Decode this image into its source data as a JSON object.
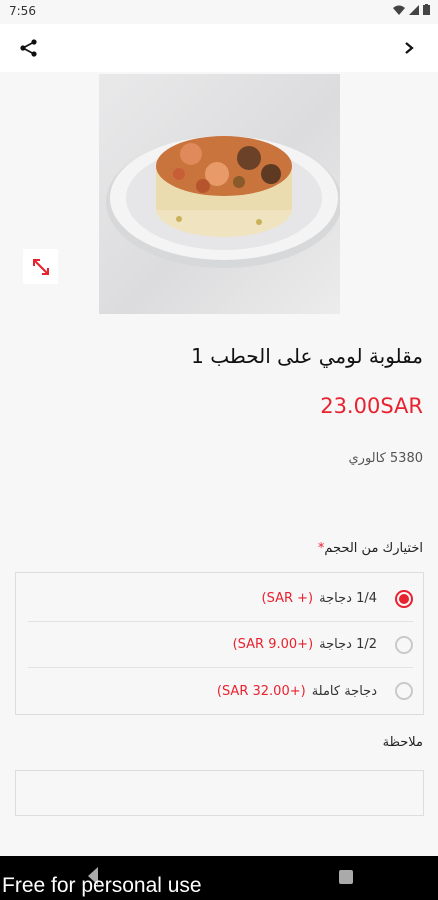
{
  "status_bar": {
    "time": "7:56"
  },
  "app_bar": {
    "share_icon": "share-icon",
    "forward_icon": "chevron-right-icon"
  },
  "product": {
    "title": "مقلوبة لومي على الحطب 1",
    "price": "23.00SAR",
    "calories": "5380 كالوري"
  },
  "size_section": {
    "label": "اختيارك من الحجم",
    "required_mark": "*",
    "options": [
      {
        "label": "1/4 دجاجة",
        "price": "(+ SAR)",
        "selected": true
      },
      {
        "label": "1/2 دجاجة",
        "price": "(+9.00 SAR)",
        "selected": false
      },
      {
        "label": "دجاجة كاملة",
        "price": "(+32.00 SAR)",
        "selected": false
      }
    ]
  },
  "note": {
    "label": "ملاحظة",
    "value": ""
  },
  "watermark": "Free for personal use",
  "colors": {
    "accent": "#e8222f"
  }
}
